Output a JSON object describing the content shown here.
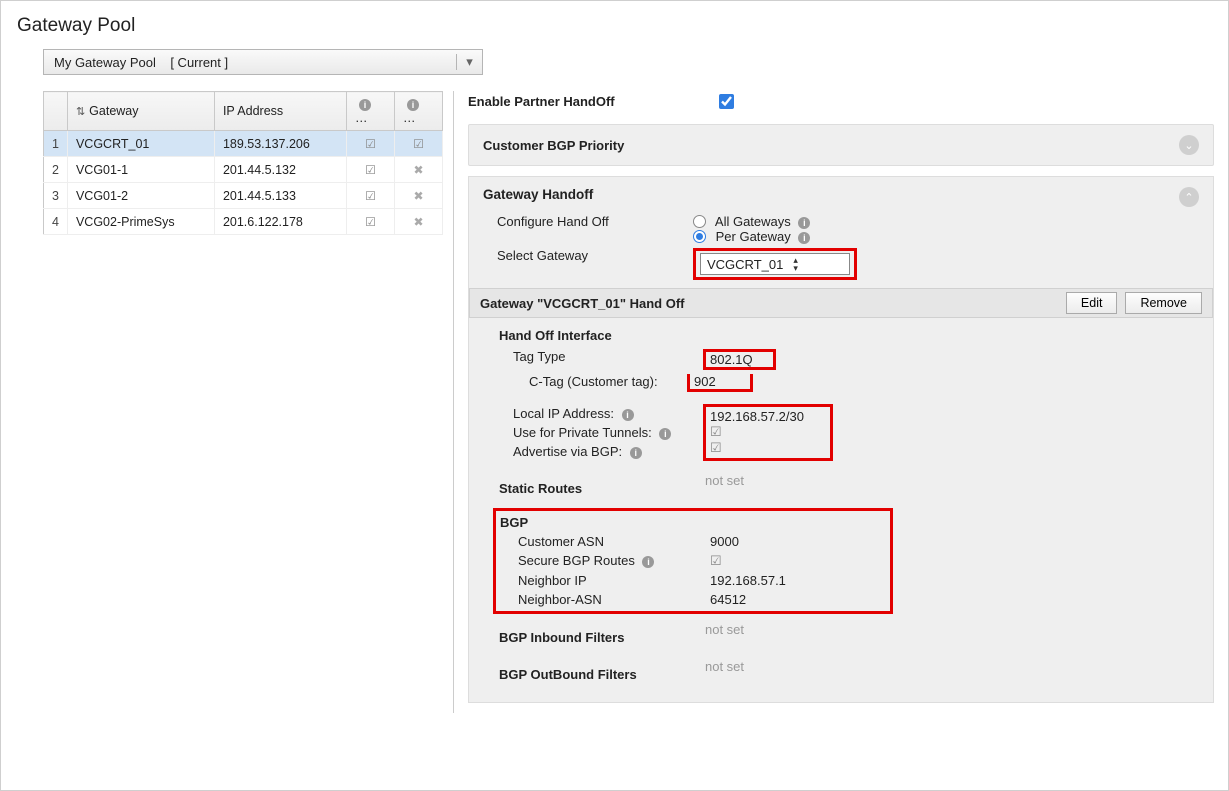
{
  "title": "Gateway Pool",
  "pool_selector": {
    "name": "My Gateway Pool",
    "tag": "[ Current ]"
  },
  "gateway_table": {
    "headers": {
      "gateway": "Gateway",
      "ip": "IP Address",
      "c3": "…",
      "c4": "…"
    },
    "rows": [
      {
        "idx": "1",
        "name": "VCGCRT_01",
        "ip": "189.53.137.206",
        "c3": true,
        "c4": true,
        "selected": true
      },
      {
        "idx": "2",
        "name": "VCG01-1",
        "ip": "201.44.5.132",
        "c3": true,
        "c4": false
      },
      {
        "idx": "3",
        "name": "VCG01-2",
        "ip": "201.44.5.133",
        "c3": true,
        "c4": false
      },
      {
        "idx": "4",
        "name": "VCG02-PrimeSys",
        "ip": "201.6.122.178",
        "c3": true,
        "c4": false
      }
    ]
  },
  "right": {
    "enable_label": "Enable Partner HandOff",
    "enable_checked": true,
    "accordion1_title": "Customer BGP Priority",
    "handoff": {
      "title": "Gateway Handoff",
      "configure_label": "Configure Hand Off",
      "opt_all": "All Gateways",
      "opt_per": "Per Gateway",
      "select_gw_label": "Select Gateway",
      "select_gw_value": "VCGCRT_01"
    },
    "gw_detail": {
      "header": "Gateway \"VCGCRT_01\" Hand Off",
      "edit": "Edit",
      "remove": "Remove",
      "handoff_if_title": "Hand Off Interface",
      "tag_type_label": "Tag Type",
      "tag_type_value": "802.1Q",
      "ctag_label": "C-Tag (Customer tag):",
      "ctag_value": "902",
      "local_ip_label": "Local IP Address:",
      "local_ip_value": "192.168.57.2/30",
      "use_priv_label": "Use for Private Tunnels:",
      "adv_bgp_label": "Advertise via BGP:",
      "static_routes_title": "Static Routes",
      "static_routes_value": "not set",
      "bgp_title": "BGP",
      "cust_asn_label": "Customer ASN",
      "cust_asn_value": "9000",
      "secure_label": "Secure BGP Routes",
      "neighbor_ip_label": "Neighbor IP",
      "neighbor_ip_value": "192.168.57.1",
      "neighbor_asn_label": "Neighbor-ASN",
      "neighbor_asn_value": "64512",
      "bgp_in_title": "BGP Inbound Filters",
      "bgp_in_value": "not set",
      "bgp_out_title": "BGP OutBound Filters",
      "bgp_out_value": "not set"
    }
  },
  "info_icon_label": "i"
}
